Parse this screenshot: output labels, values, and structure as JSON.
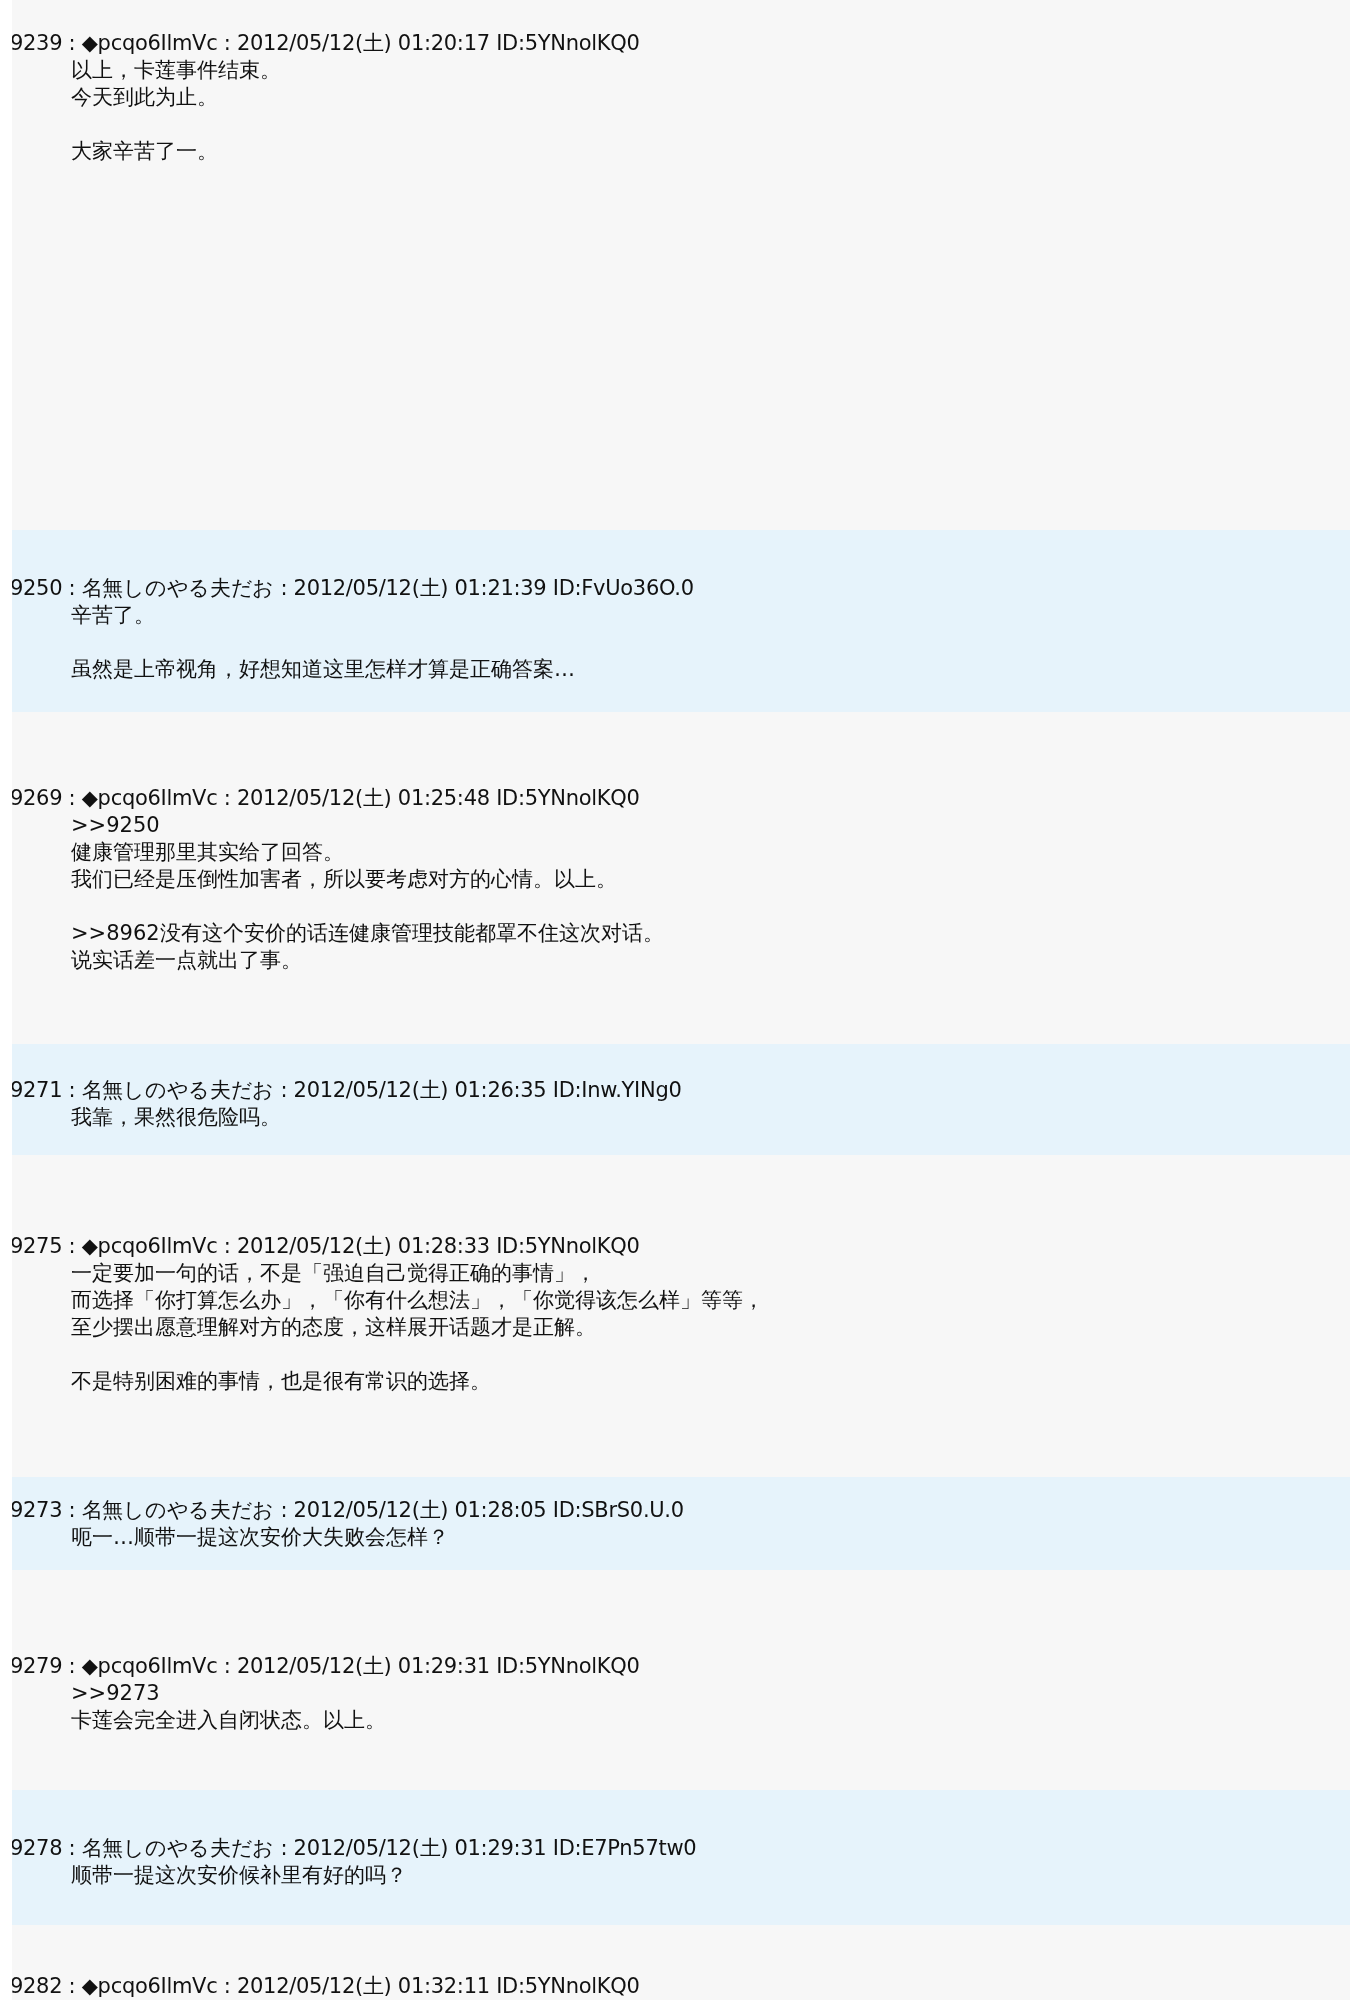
{
  "posts": [
    {
      "kind": "trip",
      "header": "9239 : ◆pcqo6IlmVc : 2012/05/12(土) 01:20:17 ID:5YNnolKQ0",
      "body": [
        [
          "以上，卡莲事件结束。",
          "今天到此为止。"
        ],
        [
          "大家辛苦了一。"
        ]
      ]
    },
    {
      "kind": "anon",
      "header": "9250 : 名無しのやる夫だお : 2012/05/12(土) 01:21:39 ID:FvUo36O.0",
      "body": [
        [
          "辛苦了。"
        ],
        [
          "虽然是上帝视角，好想知道这里怎样才算是正确答案…"
        ]
      ]
    },
    {
      "kind": "trip",
      "header": "9269 : ◆pcqo6IlmVc : 2012/05/12(土) 01:25:48 ID:5YNnolKQ0",
      "body": [
        [
          ">>9250",
          "健康管理那里其实给了回答。",
          "我们已经是压倒性加害者，所以要考虑对方的心情。以上。"
        ],
        [
          ">>8962没有这个安价的话连健康管理技能都罩不住这次对话。",
          "说实话差一点就出了事。"
        ]
      ]
    },
    {
      "kind": "anon",
      "header": "9271 : 名無しのやる夫だお : 2012/05/12(土) 01:26:35 ID:Inw.YINg0",
      "body": [
        [
          "我靠，果然很危险吗。"
        ]
      ]
    },
    {
      "kind": "trip",
      "header": "9275 : ◆pcqo6IlmVc : 2012/05/12(土) 01:28:33 ID:5YNnolKQ0",
      "body": [
        [
          "一定要加一句的话，不是「强迫自己觉得正确的事情」，",
          "而选择「你打算怎么办」，「你有什么想法」，「你觉得该怎么样」等等，",
          "至少摆出愿意理解对方的态度，这样展开话题才是正解。"
        ],
        [
          "不是特别困难的事情，也是很有常识的选择。"
        ]
      ]
    },
    {
      "kind": "anon",
      "header": "9273 : 名無しのやる夫だお : 2012/05/12(土) 01:28:05 ID:SBrS0.U.0",
      "body": [
        [
          "呃一…顺带一提这次安价大失败会怎样？"
        ]
      ]
    },
    {
      "kind": "trip",
      "header": "9279 : ◆pcqo6IlmVc : 2012/05/12(土) 01:29:31 ID:5YNnolKQ0",
      "body": [
        [
          ">>9273",
          "卡莲会完全进入自闭状态。以上。"
        ]
      ]
    },
    {
      "kind": "anon",
      "header": "9278 : 名無しのやる夫だお : 2012/05/12(土) 01:29:31 ID:E7Pn57tw0",
      "body": [
        [
          "顺带一提这次安价候补里有好的吗？"
        ]
      ]
    },
    {
      "kind": "trip",
      "header": "9282 : ◆pcqo6IlmVc : 2012/05/12(土) 01:32:11 ID:5YNnolKQ0"
    }
  ]
}
